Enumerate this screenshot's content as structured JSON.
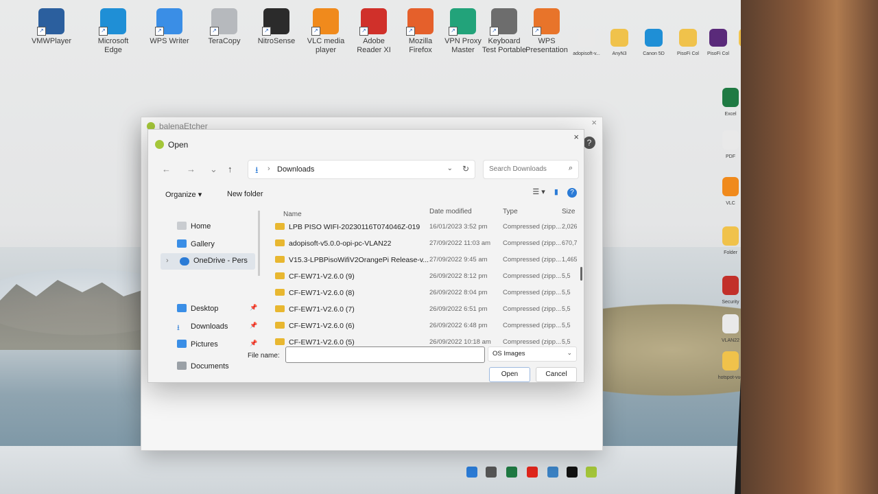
{
  "desktop": {
    "icons_top": [
      {
        "label": "VMWPlayer",
        "color": "#2b5f9e"
      },
      {
        "label": "Microsoft Edge",
        "color": "#1f8fd6"
      },
      {
        "label": "WPS Writer",
        "color": "#3a8ee6"
      },
      {
        "label": "TeraCopy",
        "color": "#b6b9bd"
      },
      {
        "label": "NitroSense",
        "color": "#2b2b2b"
      },
      {
        "label": "VLC media player",
        "color": "#f08a1c"
      },
      {
        "label": "Adobe Reader XI",
        "color": "#d0302a"
      },
      {
        "label": "Mozilla Firefox",
        "color": "#e5602b"
      },
      {
        "label": "VPN Proxy Master",
        "color": "#22a37a"
      },
      {
        "label": "Keyboard Test Portable",
        "color": "#6d6d6d"
      },
      {
        "label": "WPS Presentation",
        "color": "#e8742a"
      },
      {
        "label": "adopisoft-v...",
        "color": "#e9e9e9"
      },
      {
        "label": "AnyN3",
        "color": "#f0c24b"
      },
      {
        "label": "Canon 5D",
        "color": "#1f8fd6"
      },
      {
        "label": "PisoFi Col",
        "color": "#f0c24b"
      },
      {
        "label": "PisoFi Col",
        "color": "#5a2a7a"
      },
      {
        "label": "",
        "color": "#f0c24b"
      }
    ],
    "icons_right": [
      {
        "label": "Excel",
        "color": "#1f7a43"
      },
      {
        "label": "PDF",
        "color": "#e9e9e9"
      },
      {
        "label": "VLC",
        "color": "#f08a1c"
      },
      {
        "label": "Folder",
        "color": "#f0c24b"
      },
      {
        "label": "Security",
        "color": "#c2302a"
      },
      {
        "label": "VLAN22",
        "color": "#e9e9e9"
      },
      {
        "label": "hotspot-vue",
        "color": "#f0c24b"
      }
    ]
  },
  "etcher": {
    "title": "balenaEtcher",
    "help": "?",
    "close": "×"
  },
  "dialog": {
    "title": "Open",
    "close": "×",
    "nav": {
      "back": "←",
      "forward": "→",
      "recent": "⌄",
      "up": "↑"
    },
    "address": {
      "current": "Downloads",
      "chev": "⌄",
      "refresh": "↻"
    },
    "search_placeholder": "Search Downloads",
    "toolbar": {
      "organize": "Organize ▾",
      "new_folder": "New folder"
    },
    "nav_items": {
      "home": "Home",
      "gallery": "Gallery",
      "onedrive": "OneDrive - Pers",
      "desktop": "Desktop",
      "downloads": "Downloads",
      "pictures": "Pictures",
      "documents": "Documents"
    },
    "columns": {
      "name": "Name",
      "date": "Date modified",
      "type": "Type",
      "size": "Size"
    },
    "files": [
      {
        "name": "LPB PISO WIFI-20230116T074046Z-019",
        "date": "16/01/2023 3:52 pm",
        "type": "Compressed (zipp...",
        "size": "2,026"
      },
      {
        "name": "adopisoft-v5.0.0-opi-pc-VLAN22",
        "date": "27/09/2022 11:03 am",
        "type": "Compressed (zipp...",
        "size": "670,7"
      },
      {
        "name": "V15.3-LPBPisoWifiV2OrangePi Release-v...",
        "date": "27/09/2022 9:45 am",
        "type": "Compressed (zipp...",
        "size": "1,465"
      },
      {
        "name": "CF-EW71-V2.6.0 (9)",
        "date": "26/09/2022 8:12 pm",
        "type": "Compressed (zipp...",
        "size": "5,5"
      },
      {
        "name": "CF-EW71-V2.6.0 (8)",
        "date": "26/09/2022 8:04 pm",
        "type": "Compressed (zipp...",
        "size": "5,5"
      },
      {
        "name": "CF-EW71-V2.6.0 (7)",
        "date": "26/09/2022 6:51 pm",
        "type": "Compressed (zipp...",
        "size": "5,5"
      },
      {
        "name": "CF-EW71-V2.6.0 (6)",
        "date": "26/09/2022 6:48 pm",
        "type": "Compressed (zipp...",
        "size": "5,5"
      },
      {
        "name": "CF-EW71-V2.6.0 (5)",
        "date": "26/09/2022 10:18 am",
        "type": "Compressed (zipp...",
        "size": "5,5"
      }
    ],
    "file_name_label": "File name:",
    "file_name_value": "",
    "file_type": "OS Images",
    "open_button": "Open",
    "cancel_button": "Cancel"
  },
  "colors": {
    "accent": "#2b7bd6",
    "folder": "#e8b730",
    "etcher_green": "#a4c639"
  }
}
